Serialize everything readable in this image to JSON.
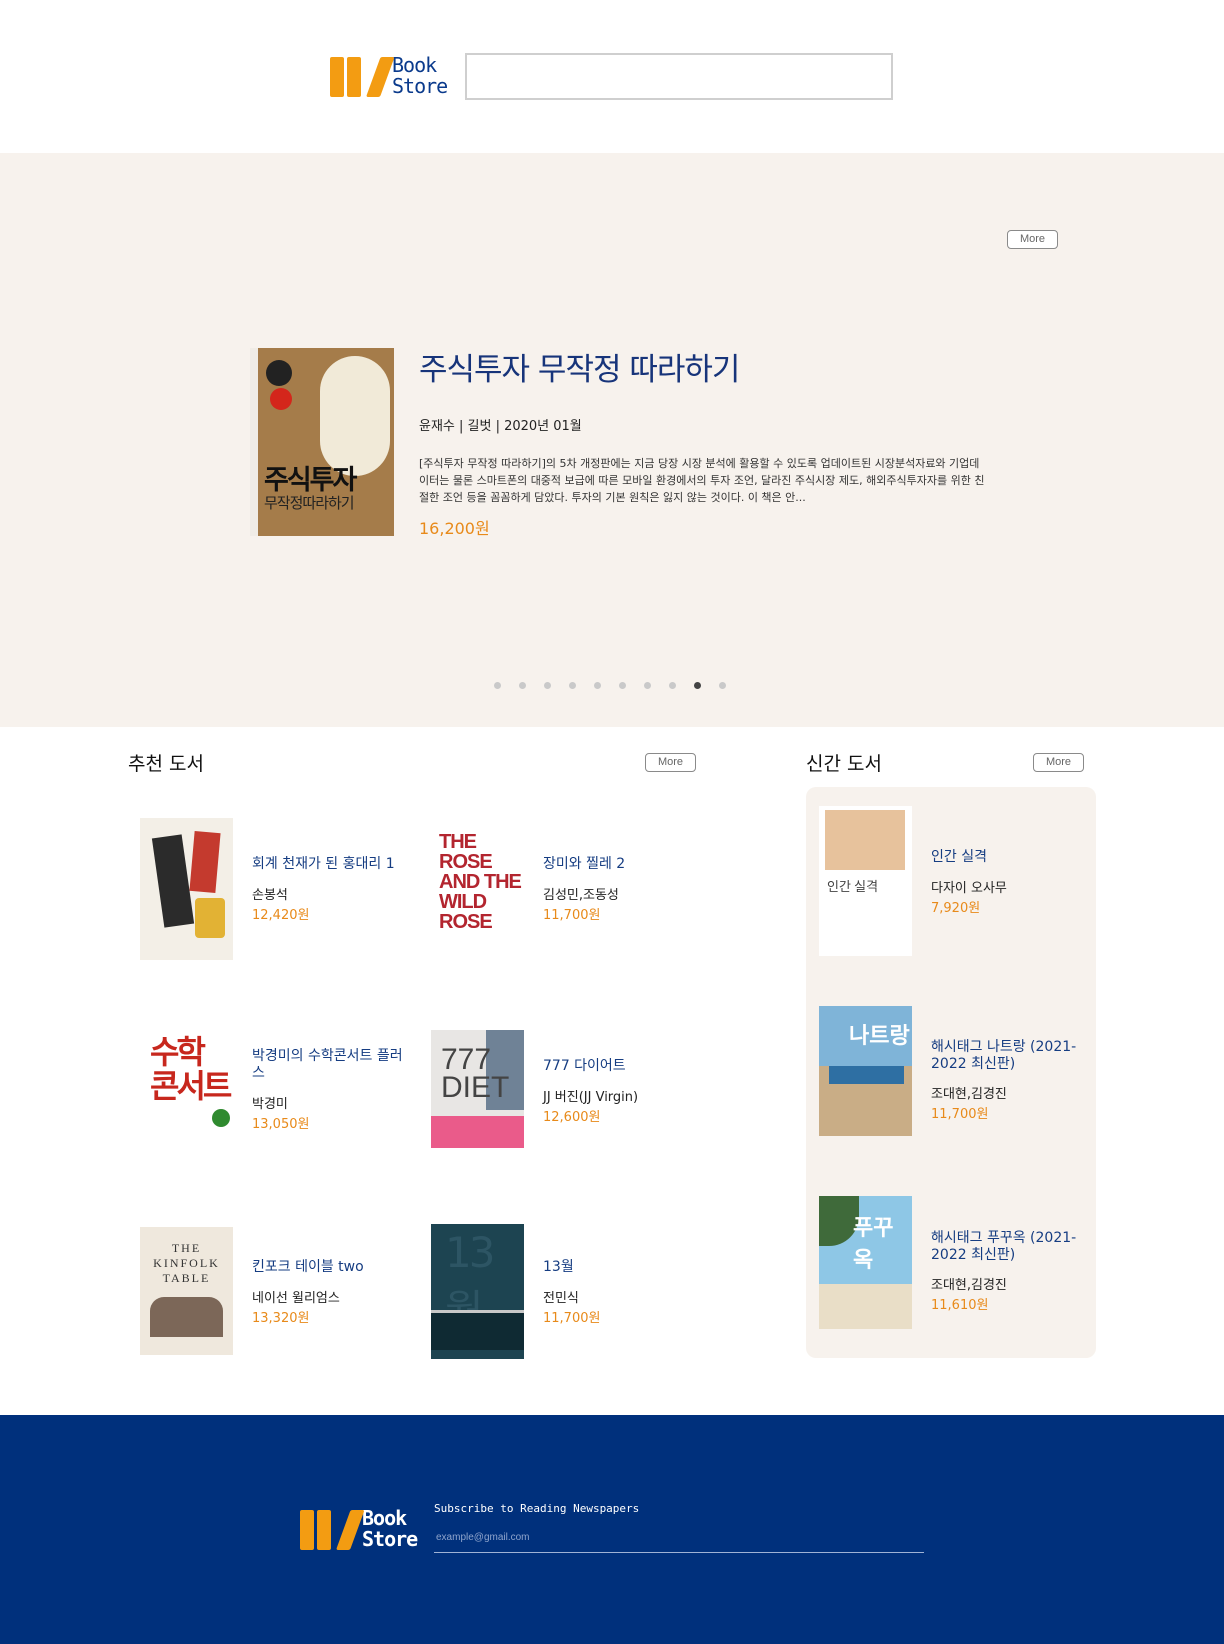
{
  "header": {
    "logo_line1": "Book",
    "logo_line2": "Store",
    "search_placeholder": ""
  },
  "hero": {
    "more_label": "More",
    "cover": {
      "title_line1": "주식투자",
      "title_line2": "무작정따라하기"
    },
    "title": "주식투자 무작정 따라하기",
    "meta": "윤재수 | 길벗 | 2020년 01월",
    "description": "[주식투자 무작정 따라하기]의 5차 개정판에는 지금 당장 시장 분석에 활용할 수 있도록 업데이트된 시장분석자료와 기업데이터는 물론 스마트폰의 대중적 보급에 따른 모바일 환경에서의 투자 조언, 달라진 주식시장 제도, 해외주식투자자를 위한 친절한 조언 등을 꼼꼼하게 담았다. 투자의 기본 원칙은 잃지 않는 것이다. 이 책은 안...",
    "price": "16,200원",
    "slide_count": 10,
    "active_slide": 9
  },
  "recommended": {
    "title": "추천 도서",
    "more_label": "More",
    "books": [
      {
        "title": "회계 천재가 된 홍대리 1",
        "author": "손봉석",
        "price": "12,420원"
      },
      {
        "title": "장미와 찔레 2",
        "author": "김성민,조동성",
        "price": "11,700원",
        "cover_text": "THE ROSE AND THE WILD ROSE"
      },
      {
        "title": "박경미의 수학콘서트 플러스",
        "author": "박경미",
        "price": "13,050원",
        "cover_text": "수학 콘서트"
      },
      {
        "title": "777 다이어트",
        "author": "JJ 버진(JJ Virgin)",
        "price": "12,600원",
        "cover_text": "777 DIET"
      },
      {
        "title": "킨포크 테이블 two",
        "author": "네이선 윌리엄스",
        "price": "13,320원",
        "cover_text": "THE KINFOLK TABLE"
      },
      {
        "title": "13월",
        "author": "전민식",
        "price": "11,700원",
        "cover_text": "13월"
      }
    ]
  },
  "new_books": {
    "title": "신간 도서",
    "more_label": "More",
    "books": [
      {
        "title": "인간 실격",
        "author": "다자이 오사무",
        "price": "7,920원",
        "cover_text": "인간 실격"
      },
      {
        "title": "해시태그 나트랑 (2021-2022 최신판)",
        "author": "조대현,김경진",
        "price": "11,700원",
        "cover_text": "나트랑"
      },
      {
        "title": "해시태그 푸꾸옥 (2021-2022 최신판)",
        "author": "조대현,김경진",
        "price": "11,610원",
        "cover_text": "푸꾸옥"
      }
    ]
  },
  "footer": {
    "logo_line1": "Book",
    "logo_line2": "Store",
    "subscribe_label": "Subscribe to Reading Newspapers",
    "email_placeholder": "example@gmail.com"
  }
}
